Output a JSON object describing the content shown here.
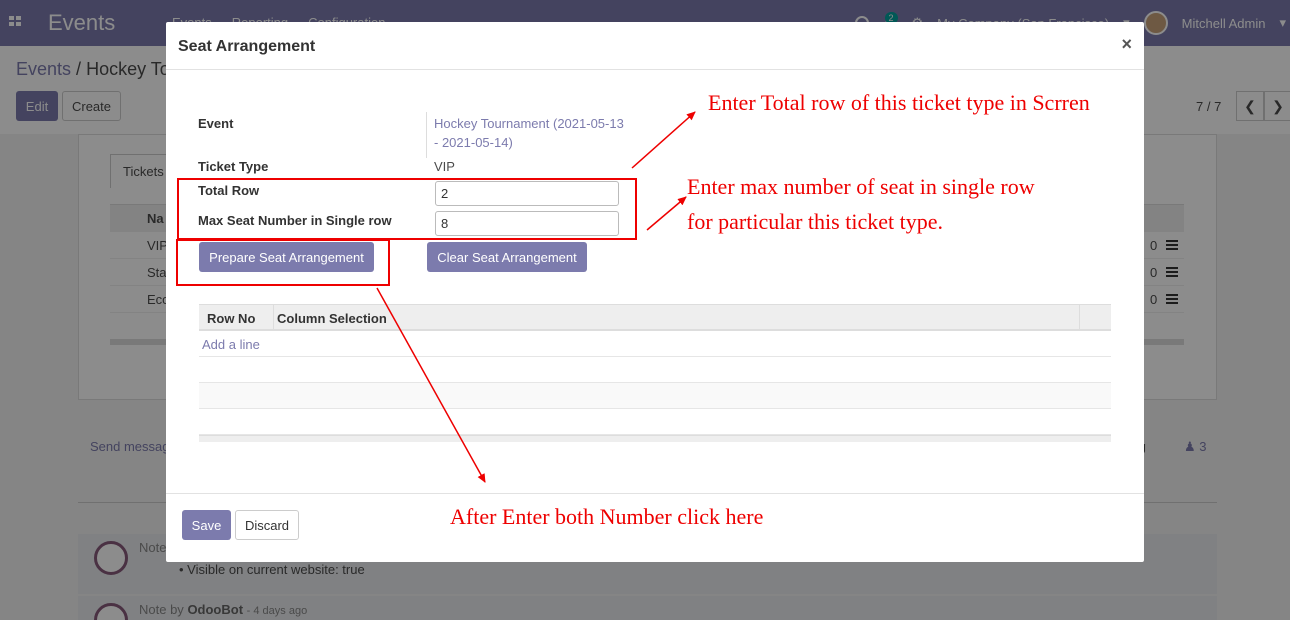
{
  "navbar": {
    "brand": "Events",
    "menu": [
      "Events",
      "Reporting",
      "Configuration"
    ],
    "chat_badge": "2",
    "company": "My Company (San Francisco)",
    "user": "Mitchell Admin"
  },
  "control_panel": {
    "breadcrumb_root": "Events",
    "breadcrumb_sep": "/",
    "breadcrumb_current": "Hockey To",
    "edit_label": "Edit",
    "create_label": "Create",
    "pager": "7 / 7"
  },
  "background_form": {
    "tab_label": "Tickets",
    "column_header": "Na",
    "rows": [
      {
        "name": "VIP",
        "count": "0"
      },
      {
        "name": "Sta",
        "count": "0"
      },
      {
        "name": "Eco",
        "count": "0"
      }
    ]
  },
  "chatter": {
    "send_message": "Send messag",
    "following": "ng",
    "followers": "3",
    "note1_head": "Note",
    "note1_bullet": "Visible on current website: true",
    "note2_head": "Note by",
    "note2_author": "OdooBot",
    "note2_time": "- 4 days ago"
  },
  "modal": {
    "title": "Seat Arrangement",
    "close": "×",
    "fields": {
      "event_label": "Event",
      "event_value": "Hockey Tournament (2021-05-13 - 2021-05-14)",
      "ticket_type_label": "Ticket Type",
      "ticket_type_value": "VIP",
      "total_row_label": "Total Row",
      "total_row_value": "2",
      "max_seat_label": "Max Seat Number in Single row",
      "max_seat_value": "8"
    },
    "prepare_button": "Prepare Seat Arrangement",
    "clear_button": "Clear Seat Arrangement",
    "table": {
      "columns": [
        "Row No",
        "Column Selection"
      ],
      "add_line": "Add a line"
    },
    "save_button": "Save",
    "discard_button": "Discard"
  },
  "annotations": {
    "total_row_note": "Enter Total row of this ticket type in Scrren",
    "max_seat_note_line1": "Enter max number of seat in single row",
    "max_seat_note_line2": "for particular this ticket type.",
    "click_note": "After Enter both Number click here",
    "color": "#ee0000"
  }
}
